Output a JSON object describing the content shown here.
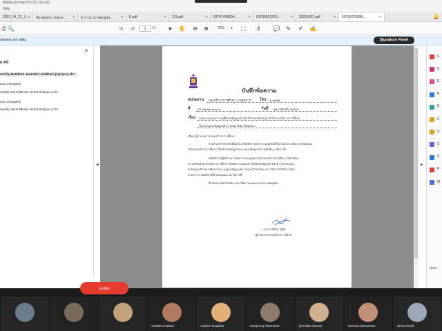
{
  "window": {
    "title": "Adobe Acrobat Pro DC (32-bit)"
  },
  "menu": {
    "help": "Help"
  },
  "tabs": [
    {
      "label": "2021_04_21_1...",
      "active": false
    },
    {
      "label": "ห้องสมุดความสะอ...",
      "active": false
    },
    {
      "label": "ตารางเวลาสอบสูงช...",
      "active": false
    },
    {
      "label": "E.pdf",
      "active": false
    },
    {
      "label": "111.pdf",
      "active": false
    },
    {
      "label": "63747445204...",
      "active": false
    },
    {
      "label": "63754521579...",
      "active": false
    },
    {
      "label": "20210422.pdf",
      "active": false
    },
    {
      "label": "63754702896...",
      "active": true
    }
  ],
  "toolbar": {
    "page_current": "1",
    "page_total": "/ 1",
    "zoom": "72%"
  },
  "signature_bar": {
    "message": "natures are valid.",
    "panel_button": "Signature Panel"
  },
  "signatures_panel": {
    "header": "e All",
    "rows": [
      {
        "text": "ned by Rattikarn Juntrakul <rattikarn.ju@up.ac.th>",
        "bold": true,
        "selected": true
      },
      {
        "text": "ious Change(s)",
        "bold": false,
        "selected": false
      },
      {
        "text": "ned by Sirirot Bhusit <sirirot.bh@up.ac.th>",
        "bold": false,
        "selected": false
      },
      {
        "text": "ious Change(s)",
        "bold": false,
        "selected": false
      },
      {
        "text": "ned by Sirirot Bhusit <sirirot.bh@up.ac.th>",
        "bold": false,
        "selected": false
      }
    ]
  },
  "document": {
    "title": "บันทึกข้อความ",
    "agency_label": "หน่วยงาน",
    "agency_value": "กองบริการการศึกษา งานธุรการ",
    "phone_label": "โทร",
    "phone_value": "๑.๑๑๑๑",
    "ref_label": "ที่",
    "ref_value": "อว ๙๑๐๑๐/๐๐๐๐",
    "date_label": "วันที่",
    "date_value": "๑๑ เมษายน ๒๕๖๔",
    "subject_label": "เรื่อง",
    "subject_line1": "ขอความอนุเคราะห์เพื่อขอข้อมูลเจ้าหน้าที่ สายสนับสนุน สังกัดกองบริการการศึกษา",
    "subject_line2": "ในระบบฐานข้อมูลบุคลากรมหาวิทยาลัยพะเยา",
    "to": "เรียน  ผู้อำนวยการกองบริการการศึกษา",
    "para1_line1": "ตามที่ มหาวิทยาลัยได้มีนโยบายให้มีการบริหารงานบุคคลให้เป็นไปตามระเบียบ สายสนับสนุน",
    "para1_line2": "สังกัดกองบริการการศึกษา ให้ปรับปรุงข้อมูลในระบบฐานข้อมูล จำนวนทั้งสิ้น ๑ อัตรา นั้น",
    "para2_line1": "เพื่อให้การปฏิบัติงานการบริหารงานบุคคลภายในกองบริการการศึกษา เป็นไปด้วย",
    "para2_line2": "ความเรียบร้อย กองบริการการศึกษา จึงขอความอนุเคราะห์เพื่อขอข้อมูลเจ้าหน้าที่ สายสนับสนุน",
    "para2_line3": "สังกัดกองบริการการศึกษา ในระบบฐานข้อมูลบุคลากรมหาวิทยาลัยพะเยา เพื่อนำไปใช้ประโยชน์",
    "para2_line4": "ตามภาระงานต่อไป  ทั้งนี้ ขอบคุณมา ณ โอกาสนี้",
    "closing": "จึงเรียนมาเพื่อโปรดพิจารณาให้ความอนุเคราะห์ จะขอบคุณยิ่ง",
    "signer_name": "(นางสาวศิริรส ภูษิต)",
    "signer_title": "ผู้อำนวยการกองบริการการศึกษา"
  },
  "right_tools": [
    {
      "label": "C",
      "color": "#e0443a"
    },
    {
      "label": "C",
      "color": "#d6336c"
    },
    {
      "label": "E",
      "color": "#e14b8b"
    },
    {
      "label": "E",
      "color": "#2d7bd6"
    },
    {
      "label": "E",
      "color": "#2fa2a0"
    },
    {
      "label": "C",
      "color": "#e0a020"
    },
    {
      "label": "S",
      "color": "#d9a521"
    },
    {
      "label": "S",
      "color": "#7a5ad6"
    },
    {
      "label": "S",
      "color": "#2e79d1"
    },
    {
      "label": "P",
      "color": "#e0443a"
    },
    {
      "label": "M",
      "color": "#4a6fd6"
    }
  ],
  "right_store": "Store",
  "video": {
    "record_button": "(ยกมือ)",
    "participants": [
      {
        "name": "",
        "color": "#6a7b8c"
      },
      {
        "name": "",
        "color": "#7a6a5a"
      },
      {
        "name": "",
        "color": "#c2a27a"
      },
      {
        "name": "Nuttida Chawiari",
        "color": "#b07a5e"
      },
      {
        "name": "unalom anuphan",
        "color": "#e0b27a"
      },
      {
        "name": "wuttiphong khamphon",
        "color": "#8c7a6a"
      },
      {
        "name": "phenlida chanrat",
        "color": "#d0b090"
      },
      {
        "name": "wannisa kamsanam",
        "color": "#c2907a"
      },
      {
        "name": "sirirot bhusit",
        "color": "#9aa8b8"
      }
    ]
  }
}
